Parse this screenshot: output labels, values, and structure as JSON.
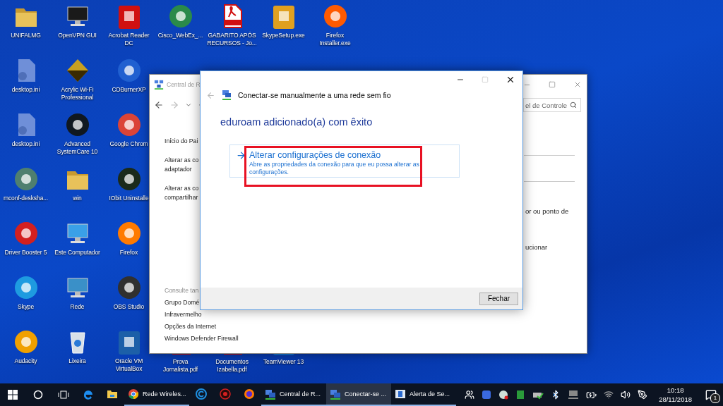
{
  "desktop": {
    "columns": [
      {
        "top": [
          {
            "label": "UNIFALMG",
            "kind": "folder",
            "color": "#e8c25a"
          },
          {
            "label": "desktop.ini",
            "kind": "file",
            "color": "#6f8fd8"
          },
          {
            "label": "desktop.ini",
            "kind": "file",
            "color": "#6f8fd8"
          },
          {
            "label": "mconf-desksha...",
            "kind": "round",
            "color": "#4f7f6f"
          },
          {
            "label": "Driver Booster 5",
            "kind": "round",
            "color": "#d32020"
          },
          {
            "label": "Skype",
            "kind": "round",
            "color": "#1e9be0"
          },
          {
            "label": "Audacity",
            "kind": "round",
            "color": "#f0a000"
          }
        ]
      },
      {
        "top": [
          {
            "label": "OpenVPN GUI",
            "kind": "monitor",
            "color": "#1a1a1a"
          },
          {
            "label": "Acrylic Wi-Fi Professional",
            "kind": "diamond",
            "color": "#c8a020"
          },
          {
            "label": "Advanced SystemCare 10",
            "kind": "round",
            "color": "#101820"
          },
          {
            "label": "win",
            "kind": "folder",
            "color": "#e8c25a"
          },
          {
            "label": "Este Computador",
            "kind": "monitor",
            "color": "#3aa0e8"
          },
          {
            "label": "Rede",
            "kind": "monitor",
            "color": "#3a90c8"
          },
          {
            "label": "Lixeira",
            "kind": "bin",
            "color": "#d8e0e8"
          }
        ]
      },
      {
        "top": [
          {
            "label": "Acrobat Reader DC",
            "kind": "tile",
            "color": "#d01010"
          },
          {
            "label": "CDBurnerXP",
            "kind": "round",
            "color": "#2060d0"
          },
          {
            "label": "Google Chrom",
            "kind": "round",
            "color": "#db4437"
          },
          {
            "label": "IObit Uninstalle",
            "kind": "round",
            "color": "#1a2a1a"
          },
          {
            "label": "Firefox",
            "kind": "round",
            "color": "#ff7a00"
          },
          {
            "label": "OBS Studio",
            "kind": "round",
            "color": "#303030"
          },
          {
            "label": "Oracle VM VirtualBox",
            "kind": "tile",
            "color": "#1c5fa8"
          }
        ]
      },
      {
        "top": [
          {
            "label": "Cisco_WebEx_...",
            "kind": "round",
            "color": "#2a8a4a"
          }
        ],
        "bottom": [
          {
            "label": "Prova Jornalista.pdf",
            "kind": "pdf"
          }
        ]
      },
      {
        "top": [
          {
            "label": "GABARITO APÓS RECURSOS - Jo...",
            "kind": "pdf",
            "color": "#d01010"
          }
        ],
        "bottom": [
          {
            "label": "Documentos Izabella.pdf",
            "kind": "pdf"
          }
        ]
      },
      {
        "top": [
          {
            "label": "SkypeSetup.exe",
            "kind": "tile",
            "color": "#e0a020"
          }
        ],
        "bottom": [
          {
            "label": "TeamViewer 13",
            "kind": "tile"
          }
        ]
      },
      {
        "top": [
          {
            "label": "Firefox Installer.exe",
            "kind": "round",
            "color": "#ff5a00"
          }
        ]
      }
    ]
  },
  "background_window": {
    "title": "Central de R",
    "search": {
      "value": "el de Controle"
    },
    "nav_links": [
      {
        "lines": [
          "Início do Pai"
        ]
      },
      {
        "lines": [
          "Alterar as co",
          "adaptador"
        ]
      },
      {
        "lines": [
          "Alterar as co",
          "compartilhar"
        ]
      }
    ],
    "see_also": {
      "heading": "Consulte tan",
      "links": [
        "Grupo Domé",
        "Infravermelho",
        "Opções da Internet",
        "Windows Defender Firewall"
      ]
    },
    "right_fragments": [
      "or ou ponto de",
      "ucionar"
    ]
  },
  "dialog": {
    "title": "Conectar-se manualmente a uma rede sem fio",
    "heading": "eduroam adicionado(a) com êxito",
    "option": {
      "title": "Alterar configurações de conexão",
      "description": "Abre as propriedades da conexão para que eu possa alterar as configurações.",
      "highlighted": true
    },
    "buttons": [
      "Fechar"
    ]
  },
  "taskbar": {
    "apps": [
      {
        "kind": "edge",
        "selected": false,
        "running": false
      },
      {
        "kind": "explorer",
        "selected": false,
        "running": false
      },
      {
        "kind": "chrome",
        "label": "Rede Wireles...",
        "selected": false,
        "running": true
      },
      {
        "kind": "systemcare",
        "selected": false,
        "running": false
      },
      {
        "kind": "booster",
        "selected": false,
        "running": false
      },
      {
        "kind": "firefox",
        "selected": false,
        "running": false
      },
      {
        "kind": "network",
        "label": "Central de R...",
        "selected": false,
        "running": true
      },
      {
        "kind": "network",
        "label": "Conectar-se ...",
        "selected": true,
        "running": true
      },
      {
        "kind": "alert",
        "label": "Alerta de Se...",
        "selected": false,
        "running": true
      }
    ],
    "time": "10:18",
    "date": "28/11/2018",
    "notifications": "1"
  }
}
